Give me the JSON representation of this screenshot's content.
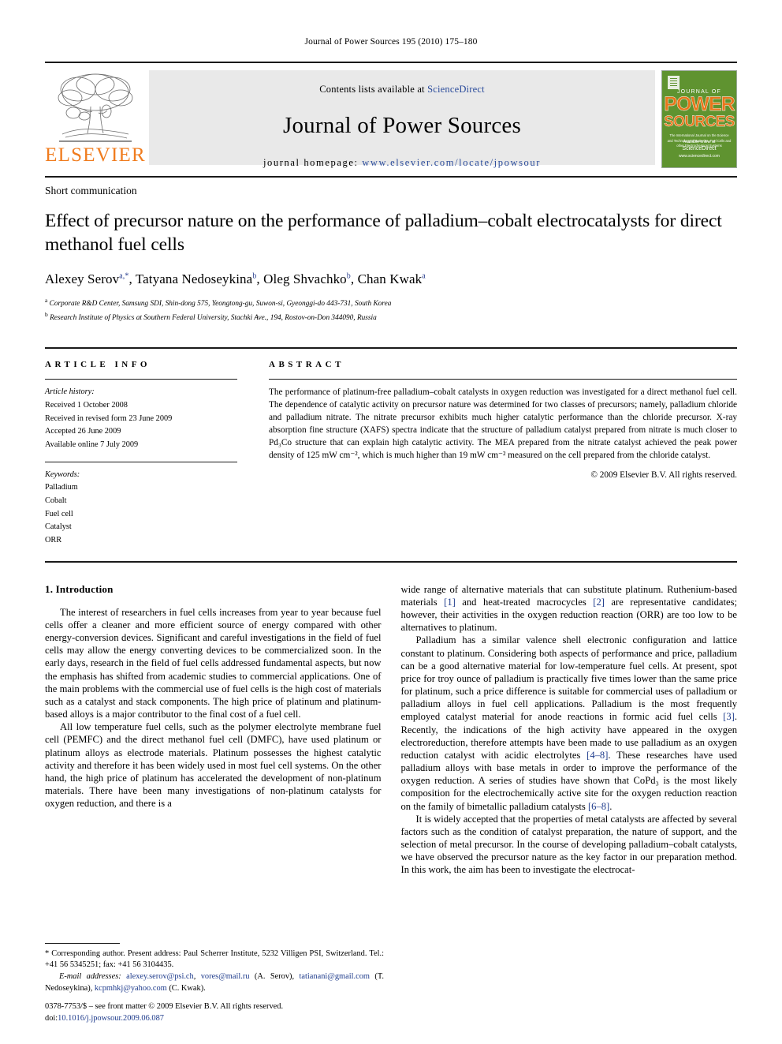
{
  "running_head": "Journal of Power Sources 195 (2010) 175–180",
  "masthead": {
    "elsevier_wordmark": "ELSEVIER",
    "contents_prefix": "Contents lists available at ",
    "contents_link": "ScienceDirect",
    "journal_title": "Journal of Power Sources",
    "homepage_prefix": "journal homepage: ",
    "homepage_url": "www.elsevier.com/locate/jpowsour",
    "cover": {
      "journal_of": "JOURNAL OF",
      "power": "POWER",
      "sources": "SOURCES",
      "blurb": "The International Journal on the Science and Technology of Batteries, Fuel Cells and other Electrochemical Systems",
      "sciencedirect_small": "Available online at",
      "sciencedirect": "ScienceDirect",
      "sciencedirect_sub": "www.sciencedirect.com"
    }
  },
  "article": {
    "doctype": "Short communication",
    "title": "Effect of precursor nature on the performance of palladium–cobalt electrocatalysts for direct methanol fuel cells",
    "authors_html": "Alexey Serov<sup>a,*</sup>, Tatyana Nedoseykina<sup>b</sup>, Oleg Shvachko<sup>b</sup>, Chan Kwak<sup>a</sup>",
    "affiliation_a": "Corporate R&D Center, Samsung SDI, Shin-dong 575, Yeongtong-gu, Suwon-si, Gyeonggi-do 443-731, South Korea",
    "affiliation_b": "Research Institute of Physics at Southern Federal University, Stachki Ave., 194, Rostov-on-Don 344090, Russia"
  },
  "article_info": {
    "heading": "ARTICLE INFO",
    "history_label": "Article history:",
    "history": [
      "Received 1 October 2008",
      "Received in revised form 23 June 2009",
      "Accepted 26 June 2009",
      "Available online 7 July 2009"
    ],
    "keywords_label": "Keywords:",
    "keywords": [
      "Palladium",
      "Cobalt",
      "Fuel cell",
      "Catalyst",
      "ORR"
    ]
  },
  "abstract": {
    "heading": "ABSTRACT",
    "text": "The performance of platinum-free palladium–cobalt catalysts in oxygen reduction was investigated for a direct methanol fuel cell. The dependence of catalytic activity on precursor nature was determined for two classes of precursors; namely, palladium chloride and palladium nitrate. The nitrate precursor exhibits much higher catalytic performance than the chloride precursor. X-ray absorption fine structure (XAFS) spectra indicate that the structure of palladium catalyst prepared from nitrate is much closer to Pd₃Co structure that can explain high catalytic activity. The MEA prepared from the nitrate catalyst achieved the peak power density of 125 mW cm⁻², which is much higher than 19 mW cm⁻² measured on the cell prepared from the chloride catalyst.",
    "copyright": "© 2009 Elsevier B.V. All rights reserved."
  },
  "body": {
    "section_title": "1.  Introduction",
    "left_paragraphs": [
      "The interest of researchers in fuel cells increases from year to year because fuel cells offer a cleaner and more efficient source of energy compared with other energy-conversion devices. Significant and careful investigations in the field of fuel cells may allow the energy converting devices to be commercialized soon. In the early days, research in the field of fuel cells addressed fundamental aspects, but now the emphasis has shifted from academic studies to commercial applications. One of the main problems with the commercial use of fuel cells is the high cost of materials such as a catalyst and stack components. The high price of platinum and platinum-based alloys is a major contributor to the final cost of a fuel cell.",
      "All low temperature fuel cells, such as the polymer electrolyte membrane fuel cell (PEMFC) and the direct methanol fuel cell (DMFC), have used platinum or platinum alloys as electrode materials. Platinum possesses the highest catalytic activity and therefore it has been widely used in most fuel cell systems. On the other hand, the high price of platinum has accelerated the development of non-platinum materials. There have been many investigations of non-platinum catalysts for oxygen reduction, and there is a"
    ],
    "right_paragraph_1_parts": [
      {
        "t": "wide range of alternative materials that can substitute platinum. Ruthenium-based materials ",
        "ref": false
      },
      {
        "t": "[1]",
        "ref": true
      },
      {
        "t": " and heat-treated macrocycles ",
        "ref": false
      },
      {
        "t": "[2]",
        "ref": true
      },
      {
        "t": " are representative candidates; however, their activities in the oxygen reduction reaction (ORR) are too low to be alternatives to platinum.",
        "ref": false
      }
    ],
    "right_paragraph_2_parts": [
      {
        "t": "Palladium has a similar valence shell electronic configuration and lattice constant to platinum. Considering both aspects of performance and price, palladium can be a good alternative material for low-temperature fuel cells. At present, spot price for troy ounce of palladium is practically five times lower than the same price for platinum, such a price difference is suitable for commercial uses of palladium or palladium alloys in fuel cell applications. Palladium is the most frequently employed catalyst material for anode reactions in formic acid fuel cells ",
        "ref": false
      },
      {
        "t": "[3]",
        "ref": true
      },
      {
        "t": ". Recently, the indications of the high activity have appeared in the oxygen electroreduction, therefore attempts have been made to use palladium as an oxygen reduction catalyst with acidic electrolytes ",
        "ref": false
      },
      {
        "t": "[4–8]",
        "ref": true
      },
      {
        "t": ". These researches have used palladium alloys with base metals in order to improve the performance of the oxygen reduction. A series of studies have shown that CoPd₃ is the most likely composition for the electrochemically active site for the oxygen reduction reaction on the family of bimetallic palladium catalysts ",
        "ref": false
      },
      {
        "t": "[6–8]",
        "ref": true
      },
      {
        "t": ".",
        "ref": false
      }
    ],
    "right_paragraph_3_parts": [
      {
        "t": "It is widely accepted that the properties of metal catalysts are affected by several factors such as the condition of catalyst preparation, the nature of support, and the selection of metal precursor. In the course of developing palladium–cobalt catalysts, we have observed the precursor nature as the key factor in our preparation method. In this work, the aim has been to investigate the electrocat-",
        "ref": false
      }
    ]
  },
  "footnotes": {
    "corresponding": "*  Corresponding author. Present address: Paul Scherrer Institute, 5232 Villigen PSI, Switzerland. Tel.: +41 56 5345251; fax: +41 56 3104435.",
    "email_label": "E-mail addresses:",
    "emails": [
      {
        "address": "alexey.serov@psi.ch",
        "sep": ", "
      },
      {
        "address": "vores@mail.ru",
        "sep": " (A. Serov), "
      },
      {
        "address": "tatianani@gmail.com",
        "sep": " (T. Nedoseykina), "
      },
      {
        "address": "kcpmhkj@yahoo.com",
        "sep": " (C. Kwak)."
      }
    ]
  },
  "imprint": {
    "issn_line": "0378-7753/$ – see front matter © 2009 Elsevier B.V. All rights reserved.",
    "doi_label": "doi:",
    "doi_value": "10.1016/j.jpowsour.2009.06.087"
  }
}
